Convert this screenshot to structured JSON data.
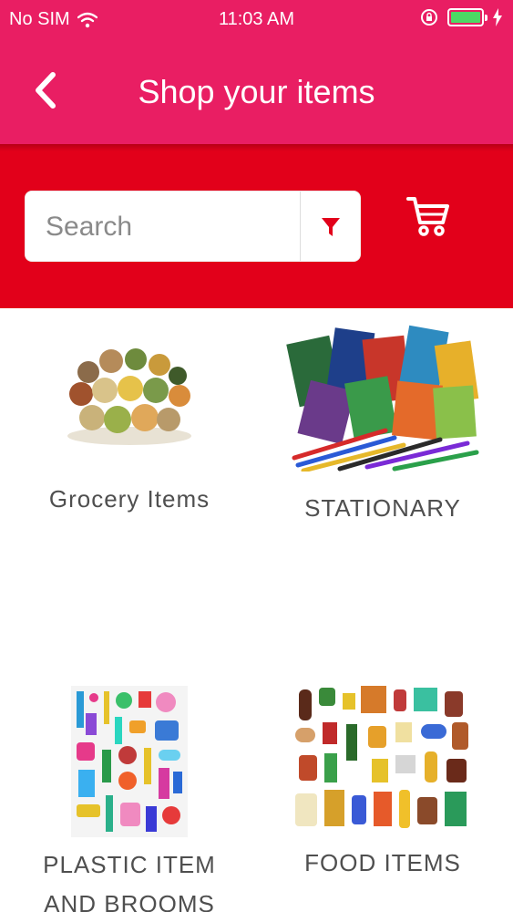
{
  "status_bar": {
    "carrier": "No SIM",
    "time": "11:03 AM"
  },
  "header": {
    "title": "Shop your items"
  },
  "search": {
    "placeholder": "Search"
  },
  "categories": [
    {
      "label": "Grocery Items"
    },
    {
      "label": "STATIONARY"
    },
    {
      "label_line1": "PLASTIC ITEM",
      "label_line2": "AND BROOMS"
    },
    {
      "label": "FOOD ITEMS"
    }
  ],
  "colors": {
    "header_bg": "#e91e63",
    "search_band_bg": "#e2001a",
    "filter_icon": "#e2001a"
  },
  "icons": [
    "wifi-icon",
    "orientation-lock-icon",
    "battery-icon",
    "charging-icon",
    "back-chevron-icon",
    "filter-icon",
    "cart-icon"
  ]
}
